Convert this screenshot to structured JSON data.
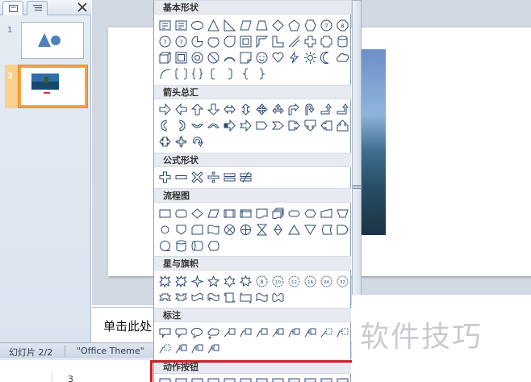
{
  "left_pane": {
    "slides": [
      {
        "number": "1",
        "content": "triangle-circle"
      },
      {
        "number": "2",
        "content": "island-photo"
      }
    ]
  },
  "notes": {
    "placeholder_text": "单击此处"
  },
  "status_bar": {
    "slide_counter": "幻灯片 2/2",
    "theme": "\"Office Theme\""
  },
  "below_status": {
    "number": "3"
  },
  "gallery": {
    "categories": [
      {
        "label": "基本形状"
      },
      {
        "label": "箭头总汇"
      },
      {
        "label": "公式形状"
      },
      {
        "label": "流程图"
      },
      {
        "label": "星与旗帜"
      },
      {
        "label": "标注"
      },
      {
        "label": "动作按钮"
      }
    ]
  },
  "watermark": {
    "text": "软件技巧"
  },
  "colors": {
    "highlight": "#c8202a",
    "shape_stroke": "#2e4a6f",
    "selected_thumb": "#f3a443"
  }
}
